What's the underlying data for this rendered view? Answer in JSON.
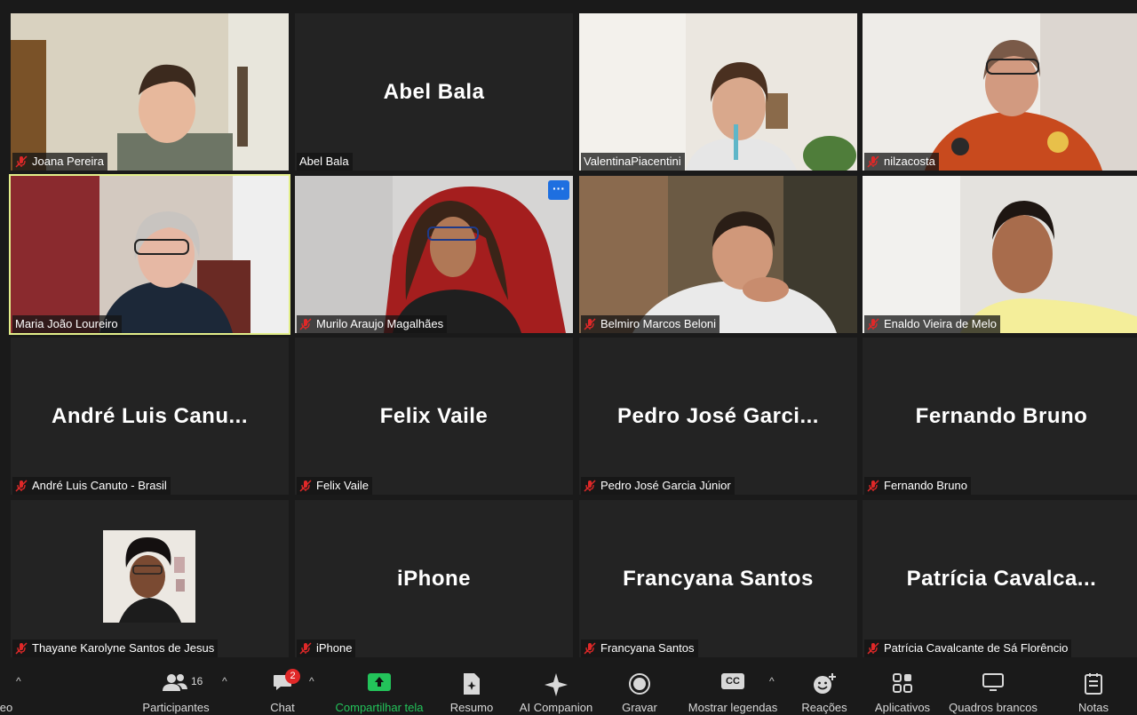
{
  "participants": [
    {
      "tile_name": "",
      "label": "Joana Pereira",
      "muted": true
    },
    {
      "tile_name": "Abel Bala",
      "label": "Abel Bala",
      "muted": false
    },
    {
      "tile_name": "",
      "label": "ValentinaPiacentini",
      "muted": false
    },
    {
      "tile_name": "",
      "label": "nilzacosta",
      "muted": true
    },
    {
      "tile_name": "",
      "label": "Maria João Loureiro",
      "muted": false
    },
    {
      "tile_name": "",
      "label": "Murilo Araujo Magalhães",
      "muted": true
    },
    {
      "tile_name": "",
      "label": "Belmiro Marcos Beloni",
      "muted": true
    },
    {
      "tile_name": "",
      "label": "Enaldo Vieira de Melo",
      "muted": true
    },
    {
      "tile_name": "André  Luis  Canu...",
      "label": "André Luis Canuto - Brasil",
      "muted": true
    },
    {
      "tile_name": "Felix Vaile",
      "label": "Felix Vaile",
      "muted": true
    },
    {
      "tile_name": "Pedro  José  Garci...",
      "label": "Pedro José Garcia Júnior",
      "muted": true
    },
    {
      "tile_name": "Fernando Bruno",
      "label": "Fernando Bruno",
      "muted": true
    },
    {
      "tile_name": "",
      "label": "Thayane Karolyne Santos de Jesus",
      "muted": true
    },
    {
      "tile_name": "iPhone",
      "label": "iPhone",
      "muted": true
    },
    {
      "tile_name": "Francyana Santos",
      "label": "Francyana Santos",
      "muted": true
    },
    {
      "tile_name": "Patrícia  Cavalca...",
      "label": "Patrícia Cavalcante de Sá Florêncio",
      "muted": true
    }
  ],
  "more_button": "···",
  "toolbar": {
    "video_label": "eo",
    "participants_label": "Participantes",
    "participants_count": "16",
    "chat_label": "Chat",
    "chat_badge": "2",
    "share_label": "Compartilhar tela",
    "summary_label": "Resumo",
    "ai_label": "AI Companion",
    "record_label": "Gravar",
    "captions_label": "Mostrar legendas",
    "captions_icon_text": "CC",
    "reactions_label": "Reações",
    "apps_label": "Aplicativos",
    "whiteboards_label": "Quadros brancos",
    "notes_label": "Notas",
    "chevron": "^"
  },
  "colors": {
    "active_speaker_border": "#e3ef8a",
    "share_green": "#23c35a",
    "mute_red": "#e02828",
    "badge_red": "#e02828"
  }
}
